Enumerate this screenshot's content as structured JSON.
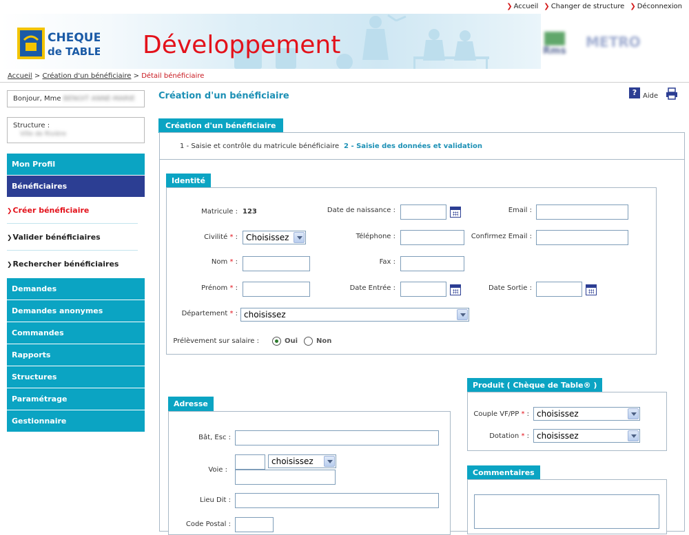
{
  "top_links": [
    {
      "label": "Accueil"
    },
    {
      "label": "Changer de structure"
    },
    {
      "label": "Déconnexion"
    }
  ],
  "banner": {
    "logo_line1": "CHEQUE",
    "logo_line2": "de TABLE",
    "title": "Développement"
  },
  "breadcrumb": {
    "home": "Accueil",
    "sep": ">",
    "parent": "Création d'un bénéficiaire",
    "current": "Détail bénéficiaire"
  },
  "user": {
    "greeting": "Bonjour, Mme",
    "name_blurred": "BENOIT ANNE-MARIE",
    "structure_label": "Structure :",
    "structure_blurred": "Ville de Rivière"
  },
  "nav": {
    "mon_profil": "Mon Profil",
    "beneficiaires": "Bénéficiaires",
    "sub": [
      "Créer bénéficiaire",
      "Valider bénéficiaires",
      "Rechercher bénéficiaires"
    ],
    "items": [
      "Demandes",
      "Demandes anonymes",
      "Commandes",
      "Rapports",
      "Structures",
      "Paramétrage",
      "Gestionnaire"
    ]
  },
  "main": {
    "page_title": "Création d'un bénéficiaire",
    "help_label": "Aide",
    "tab_label": "Création d'un bénéficiaire",
    "step1": "1 - Saisie et contrôle du matricule bénéficiaire",
    "step2": "2 - Saisie des données et validation"
  },
  "identite": {
    "title": "Identité",
    "matricule_label": "Matricule :",
    "matricule_value": "123",
    "civilite_label": "Civilité",
    "civilite_value": "Choisissez",
    "nom_label": "Nom",
    "prenom_label": "Prénom",
    "departement_label": "Département",
    "departement_value": "choisissez",
    "prelevement_label": "Prélèvement sur salaire :",
    "oui": "Oui",
    "non": "Non",
    "naissance_label": "Date de naissance :",
    "telephone_label": "Téléphone :",
    "fax_label": "Fax :",
    "entree_label": "Date Entrée :",
    "email_label": "Email :",
    "confirm_email_label": "Confirmez Email :",
    "sortie_label": "Date Sortie :",
    "required_mark": "*",
    "colon": ":"
  },
  "produit": {
    "title": "Produit ( Chèque de Table® )",
    "couple_label": "Couple VF/PP",
    "couple_value": "choisissez",
    "dotation_label": "Dotation",
    "dotation_value": "choisissez"
  },
  "adresse": {
    "title": "Adresse",
    "bat_label": "Bât, Esc :",
    "voie_label": "Voie :",
    "voie_type_value": "choisissez",
    "lieu_label": "Lieu Dit :",
    "cp_label": "Code Postal :"
  },
  "commentaires": {
    "title": "Commentaires"
  }
}
